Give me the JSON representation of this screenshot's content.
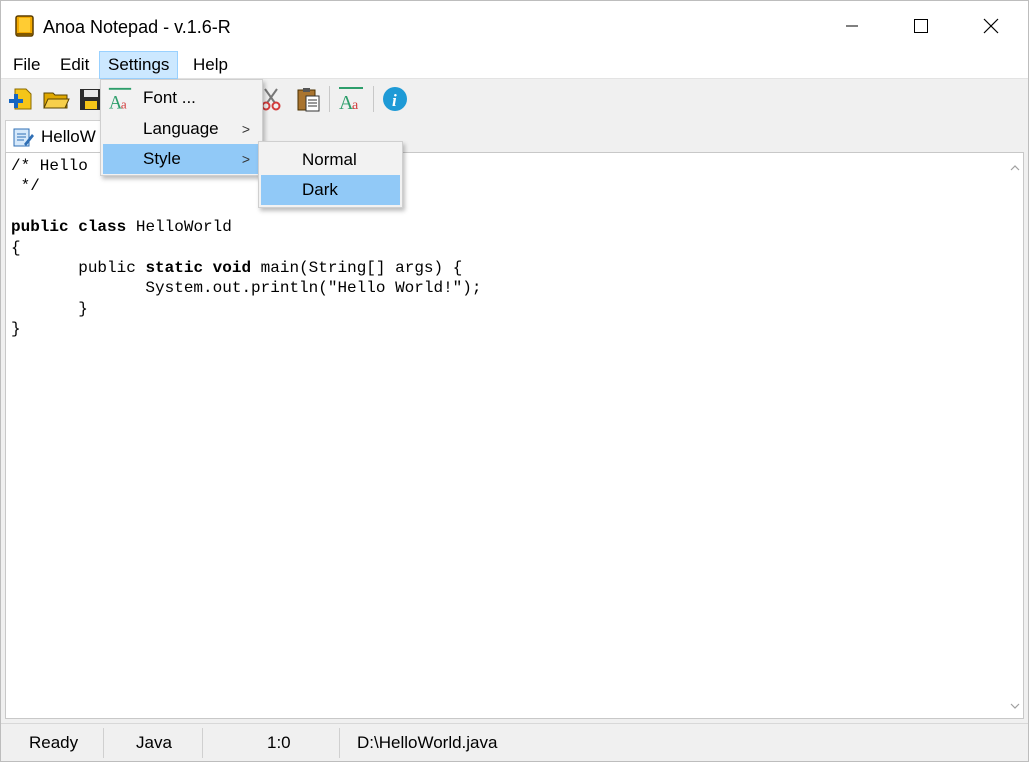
{
  "window": {
    "title": "Anoa Notepad - v.1.6-R"
  },
  "menubar": {
    "file": "File",
    "edit": "Edit",
    "settings": "Settings",
    "help": "Help"
  },
  "toolbar": {
    "icons": [
      "new-file-icon",
      "open-folder-icon",
      "save-icon",
      "font-icon",
      "cut-icon",
      "paste-icon",
      "font-icon",
      "info-icon"
    ]
  },
  "tab": {
    "label": "HelloW"
  },
  "editor": {
    "lines": [
      "/* Hello",
      " */",
      "",
      "public class HelloWorld",
      "{",
      "       public static void main(String[] args) {",
      "              System.out.println(\"Hello World!\");",
      "       }",
      "}"
    ]
  },
  "status": {
    "state": "Ready",
    "language": "Java",
    "position": "1:0",
    "path": "D:\\HelloWorld.java"
  },
  "settings_menu": {
    "font": "Font ...",
    "language": "Language",
    "style": "Style",
    "arrow": ">"
  },
  "style_menu": {
    "normal": "Normal",
    "dark": "Dark"
  },
  "colors": {
    "menu_highlight": "#91c9f7",
    "menu_open": "#cce8ff",
    "info_blue": "#1e9ad6",
    "font_icon_green": "#2d9e6b",
    "font_icon_red": "#d23c3c"
  }
}
